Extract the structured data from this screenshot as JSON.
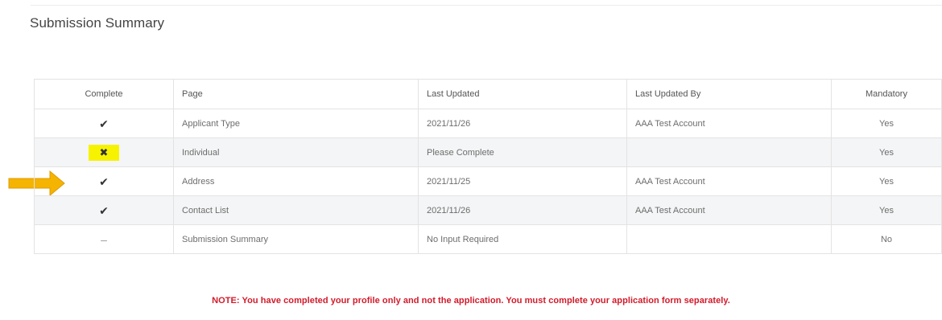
{
  "page": {
    "title": "Submission Summary"
  },
  "table": {
    "headers": {
      "complete": "Complete",
      "page": "Page",
      "last_updated": "Last Updated",
      "last_updated_by": "Last Updated By",
      "mandatory": "Mandatory"
    },
    "rows": [
      {
        "status": "complete",
        "status_glyph": "✔",
        "page": "Applicant Type",
        "last_updated": "2021/11/26",
        "last_updated_by": "AAA Test Account",
        "mandatory": "Yes"
      },
      {
        "status": "incomplete",
        "status_glyph": "✖",
        "page": "Individual",
        "last_updated": "Please Complete",
        "last_updated_by": "",
        "mandatory": "Yes"
      },
      {
        "status": "complete",
        "status_glyph": "✔",
        "page": "Address",
        "last_updated": "2021/11/25",
        "last_updated_by": "AAA Test Account",
        "mandatory": "Yes"
      },
      {
        "status": "complete",
        "status_glyph": "✔",
        "page": "Contact List",
        "last_updated": "2021/11/26",
        "last_updated_by": "AAA Test Account",
        "mandatory": "Yes"
      },
      {
        "status": "none",
        "status_glyph": "–",
        "page": "Submission Summary",
        "last_updated": "No Input Required",
        "last_updated_by": "",
        "mandatory": "No"
      }
    ]
  },
  "note": {
    "text": "NOTE: You have completed your profile only and not the application. You must complete your application form separately."
  },
  "colors": {
    "note": "#d21a2a",
    "highlight": "#f7f300",
    "arrow": "#f4b400"
  },
  "icons": {
    "complete": "check-icon",
    "incomplete": "cross-icon",
    "none": "dash-icon",
    "pointer": "arrow-right-icon"
  }
}
